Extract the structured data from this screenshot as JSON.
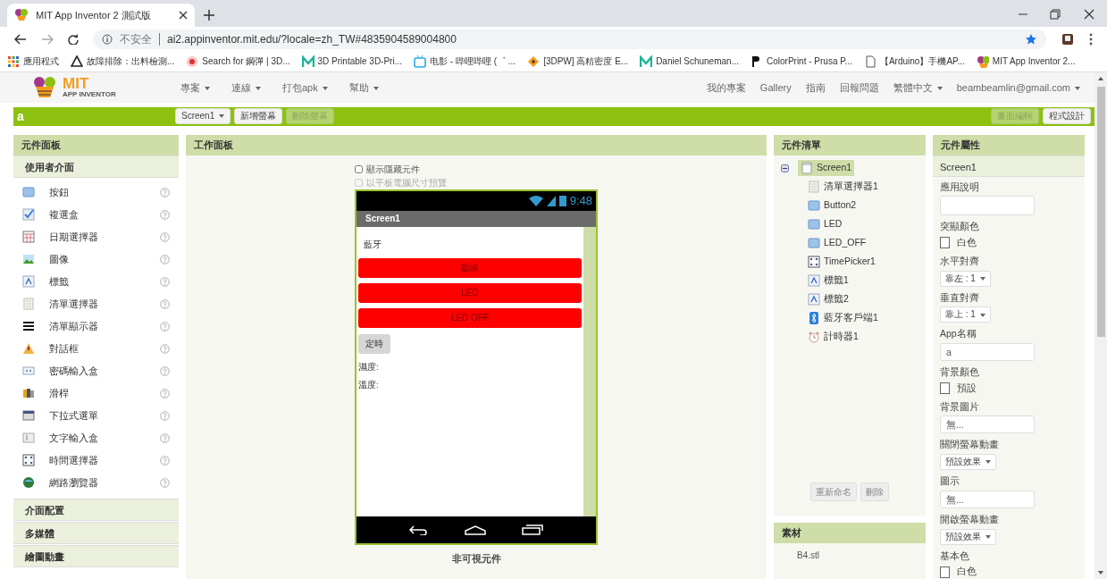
{
  "browser": {
    "tab": {
      "title": "MIT App Inventor 2 測試版"
    },
    "security": "不安全",
    "url": "ai2.appinventor.mit.edu/?locale=zh_TW#4835904589004800",
    "bookmarks": [
      {
        "kind": "apps",
        "label": "應用程式"
      },
      {
        "kind": "triangle",
        "label": "故障排除：出料檢測..."
      },
      {
        "kind": "flower",
        "label": "Search for 鋼彈 | 3D..."
      },
      {
        "kind": "m",
        "label": "3D Printable 3D-Pri..."
      },
      {
        "kind": "tv",
        "label": "电影 - 哔哩哔哩 (゜ ..."
      },
      {
        "kind": "diamond",
        "label": "[3DPW] 高精密度 E..."
      },
      {
        "kind": "m",
        "label": "Daniel Schuneman..."
      },
      {
        "kind": "pp",
        "label": "ColorPrint - Prusa P..."
      },
      {
        "kind": "page",
        "label": "【Arduino】手機AP..."
      },
      {
        "kind": "ai",
        "label": "MIT App Inventor 2..."
      }
    ]
  },
  "app": {
    "logo": {
      "title": "MIT",
      "subtitle": "APP INVENTOR"
    },
    "menus": [
      "專案",
      "連線",
      "打包apk",
      "幫助"
    ],
    "links": [
      {
        "label": "我的專案",
        "dropdown": false
      },
      {
        "label": "Gallery",
        "dropdown": false
      },
      {
        "label": "指南",
        "dropdown": false
      },
      {
        "label": "回報問題",
        "dropdown": false
      },
      {
        "label": "繁體中文",
        "dropdown": true
      },
      {
        "label": "beambeamlin@gmail.com",
        "dropdown": true
      }
    ]
  },
  "toolbar": {
    "project": "a",
    "screen": "Screen1",
    "buttons": [
      {
        "label": "新增螢幕",
        "disabled": false
      },
      {
        "label": "刪除螢幕",
        "disabled": true
      }
    ],
    "modes": [
      {
        "label": "畫面編輯",
        "selected": true
      },
      {
        "label": "程式設計",
        "selected": false
      }
    ]
  },
  "palette": {
    "title": "元件面板",
    "categories": [
      {
        "label": "使用者介面",
        "expanded": true,
        "items": [
          {
            "kind": "button",
            "label": "按鈕"
          },
          {
            "kind": "checkbox",
            "label": "複選盒"
          },
          {
            "kind": "datepicker",
            "label": "日期選擇器"
          },
          {
            "kind": "image",
            "label": "圖像"
          },
          {
            "kind": "label",
            "label": "標籤"
          },
          {
            "kind": "listpicker",
            "label": "清單選擇器"
          },
          {
            "kind": "listview",
            "label": "清單顯示器"
          },
          {
            "kind": "notifier",
            "label": "對話框"
          },
          {
            "kind": "password",
            "label": "密碼輸入盒"
          },
          {
            "kind": "slider",
            "label": "滑桿"
          },
          {
            "kind": "spinner",
            "label": "下拉式選單"
          },
          {
            "kind": "textbox",
            "label": "文字輸入盒"
          },
          {
            "kind": "timepicker",
            "label": "時間選擇器"
          },
          {
            "kind": "webviewer",
            "label": "網路瀏覽器"
          }
        ]
      },
      {
        "label": "介面配置",
        "expanded": false
      },
      {
        "label": "多媒體",
        "expanded": false
      },
      {
        "label": "繪圖動畫",
        "expanded": false
      }
    ]
  },
  "viewer": {
    "title": "工作面板",
    "options": [
      {
        "label": "顯示隱藏元件",
        "checked": false,
        "disabled": false
      },
      {
        "label": "以平板電腦尺寸預覽",
        "checked": false,
        "disabled": true
      }
    ],
    "phone": {
      "time": "9:48",
      "screen_title": "Screen1",
      "widgets": [
        {
          "kind": "label",
          "text": "藍牙"
        },
        {
          "kind": "colored_button",
          "text": "斷線",
          "color": "#ff0000"
        },
        {
          "kind": "colored_button",
          "text": "LED",
          "color": "#ff0000"
        },
        {
          "kind": "colored_button",
          "text": "LED OFF",
          "color": "#ff0000"
        },
        {
          "kind": "button",
          "text": "定時"
        },
        {
          "kind": "text",
          "text": "濕度:"
        },
        {
          "kind": "text",
          "text": "溫度:"
        }
      ]
    },
    "nonvisible_title": "非可視元件"
  },
  "components": {
    "title": "元件清單",
    "tree": [
      {
        "name": "Screen1",
        "kind": "screen",
        "selected": true,
        "expanded": true,
        "children": [
          {
            "name": "清單選擇器1",
            "kind": "listpicker",
            "selected": false
          },
          {
            "name": "Button2",
            "kind": "button",
            "selected": false
          },
          {
            "name": "LED",
            "kind": "button",
            "selected": false
          },
          {
            "name": "LED_OFF",
            "kind": "button",
            "selected": false
          },
          {
            "name": "TimePicker1",
            "kind": "timepicker",
            "selected": false
          },
          {
            "name": "標籤1",
            "kind": "label",
            "selected": false
          },
          {
            "name": "標籤2",
            "kind": "label",
            "selected": false
          },
          {
            "name": "藍牙客戶端1",
            "kind": "bluetooth",
            "selected": false
          },
          {
            "name": "計時器1",
            "kind": "clock",
            "selected": false
          }
        ]
      }
    ],
    "buttons": [
      "重新命名",
      "刪除"
    ]
  },
  "media": {
    "title": "素材",
    "files": [
      "B4.stl"
    ]
  },
  "properties": {
    "title": "元件屬性",
    "component": "Screen1",
    "items": [
      {
        "kind": "textarea",
        "label": "應用說明"
      },
      {
        "kind": "color",
        "label": "突顯顏色",
        "value": "白色"
      },
      {
        "kind": "dropdown",
        "label": "水平對齊",
        "value": "靠左 : 1"
      },
      {
        "kind": "dropdown",
        "label": "垂直對齊",
        "value": "靠上 : 1"
      },
      {
        "kind": "text",
        "label": "App名稱",
        "value": "a"
      },
      {
        "kind": "color",
        "label": "背景顏色",
        "value": "預設"
      },
      {
        "kind": "text",
        "label": "背景圖片",
        "value": "無..."
      },
      {
        "kind": "dropdown",
        "label": "關閉螢幕動畫",
        "value": "預設效果"
      },
      {
        "kind": "text",
        "label": "圖示",
        "value": "無..."
      },
      {
        "kind": "dropdown",
        "label": "開啟螢幕動畫",
        "value": "預設效果"
      },
      {
        "kind": "color",
        "label": "基本色",
        "value": "白色"
      }
    ]
  }
}
